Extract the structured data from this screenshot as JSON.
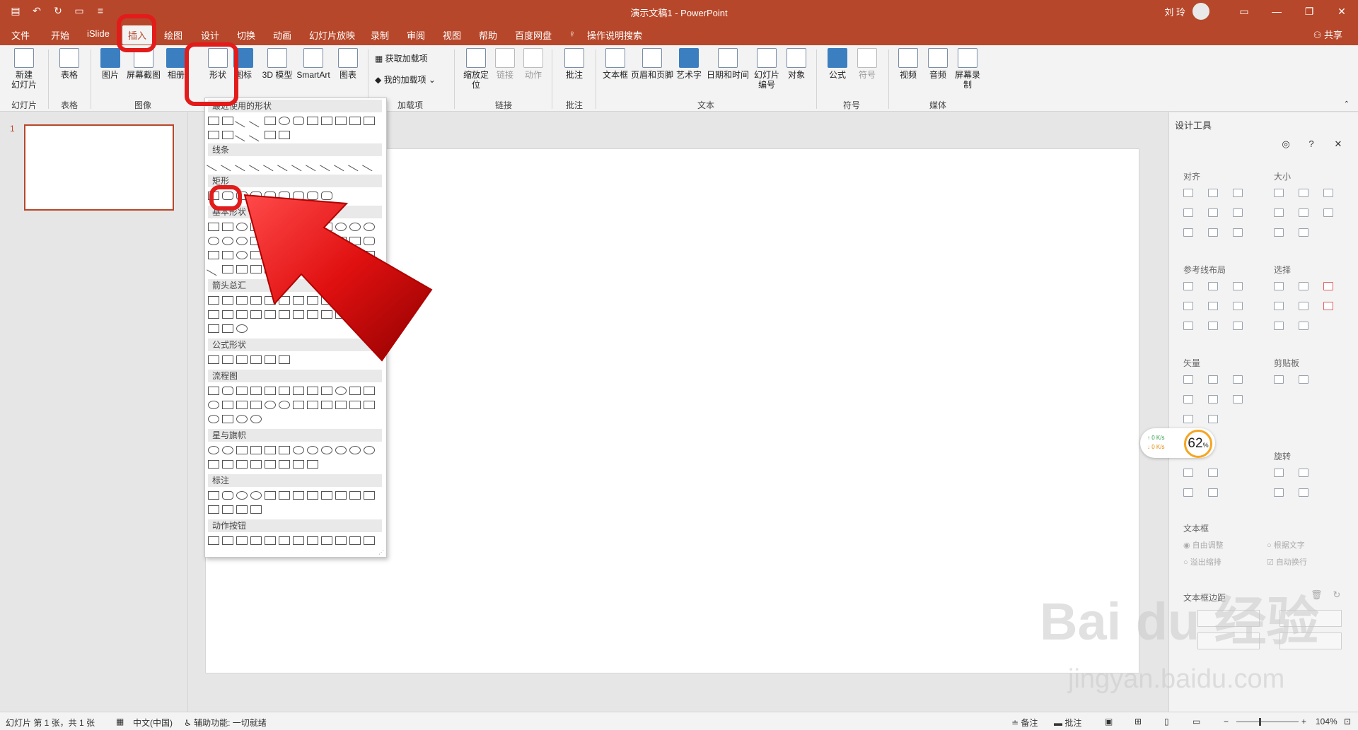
{
  "titlebar": {
    "doc_title": "演示文稿1",
    "app_name": "PowerPoint",
    "user": "刘 玲"
  },
  "tabs": [
    "文件",
    "开始",
    "iSlide",
    "插入",
    "绘图",
    "设计",
    "切换",
    "动画",
    "幻灯片放映",
    "录制",
    "审阅",
    "视图",
    "帮助",
    "百度网盘",
    "操作说明搜索"
  ],
  "active_tab": "插入",
  "share_label": "共享",
  "ribbon": {
    "buttons": {
      "new_slide": "新建\n幻灯片",
      "table": "表格",
      "picture": "图片",
      "screenshot": "屏幕截图",
      "album": "相册",
      "shapes": "形状",
      "icons": "图标",
      "model3d": "3D 模型",
      "smartart": "SmartArt",
      "chart": "图表",
      "get_addins": "获取加载项",
      "my_addins": "我的加载项",
      "zoom": "缩放定位",
      "link": "链接",
      "action": "动作",
      "comment": "批注",
      "textbox": "文本框",
      "header_footer": "页眉和页脚",
      "wordart": "艺术字",
      "datetime": "日期和时间",
      "slide_number": "幻灯片编号",
      "object": "对象",
      "equation": "公式",
      "symbol": "符号",
      "video": "视频",
      "audio": "音频",
      "screen_record": "屏幕录制"
    },
    "groups": {
      "slides": "幻灯片",
      "tables": "表格",
      "images": "图像",
      "addins": "加载项",
      "links": "链接",
      "comments": "批注",
      "text": "文本",
      "symbols": "符号",
      "media": "媒体"
    }
  },
  "shapes_panel": {
    "sections": [
      "最近使用的形状",
      "线条",
      "矩形",
      "基本形状",
      "箭头总汇",
      "公式形状",
      "流程图",
      "星与旗帜",
      "标注",
      "动作按钮"
    ]
  },
  "slide_panel": {
    "number": "1"
  },
  "design_panel": {
    "title": "设计工具",
    "sections": {
      "align": "对齐",
      "size": "大小",
      "guides": "参考线布局",
      "select": "选择",
      "vector": "矢量",
      "clipboard": "剪贴板",
      "rotate": "旋转",
      "textbox": "文本框",
      "margin": "文本框边距"
    },
    "options": {
      "auto_adjust": "自由调整",
      "by_text": "根据文字",
      "overflow": "溢出缩排",
      "auto_wrap": "自动换行"
    }
  },
  "speed_widget": {
    "up": "0 K/s",
    "down": "0 K/s",
    "percent": "62",
    "percent_unit": "%"
  },
  "statusbar": {
    "slide_info": "幻灯片 第 1 张，共 1 张",
    "language": "中文(中国)",
    "accessibility": "辅助功能: 一切就绪",
    "notes": "备注",
    "comments": "批注",
    "zoom": "104%"
  },
  "watermark": {
    "brand": "Bai du 经验",
    "url": "jingyan.baidu.com"
  },
  "colors": {
    "accent": "#b7472a",
    "highlight_ring": "#e21b1b"
  }
}
